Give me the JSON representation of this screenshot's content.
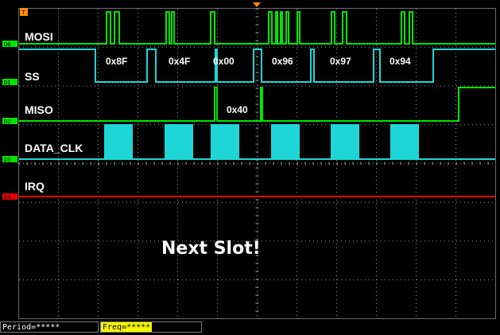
{
  "trigger_marker": "T",
  "channels": [
    {
      "tag": "D0",
      "name": "MOSI",
      "color": "#00e600"
    },
    {
      "tag": "D1",
      "name": "SS",
      "color": "#00e600"
    },
    {
      "tag": "D2",
      "name": "MISO",
      "color": "#00e600"
    },
    {
      "tag": "D3",
      "name": "DATA_CLK",
      "color": "#00e600"
    },
    {
      "tag": "D4",
      "name": "IRQ",
      "color": "#e60000"
    }
  ],
  "ss_bytes": [
    "0x8F",
    "0x4F",
    "0x00",
    "0x96",
    "0x97",
    "0x94"
  ],
  "miso_bytes": [
    "0x40"
  ],
  "annotation": "Next Slot!",
  "status": {
    "period": "Period=*****",
    "freq": "Freq=*****"
  },
  "colors": {
    "trace_high": "#1fd6d6",
    "trace_low": "#00e600",
    "irq": "#e60000",
    "grid": "#9a9a9a",
    "trigger": "#ff8c00"
  }
}
